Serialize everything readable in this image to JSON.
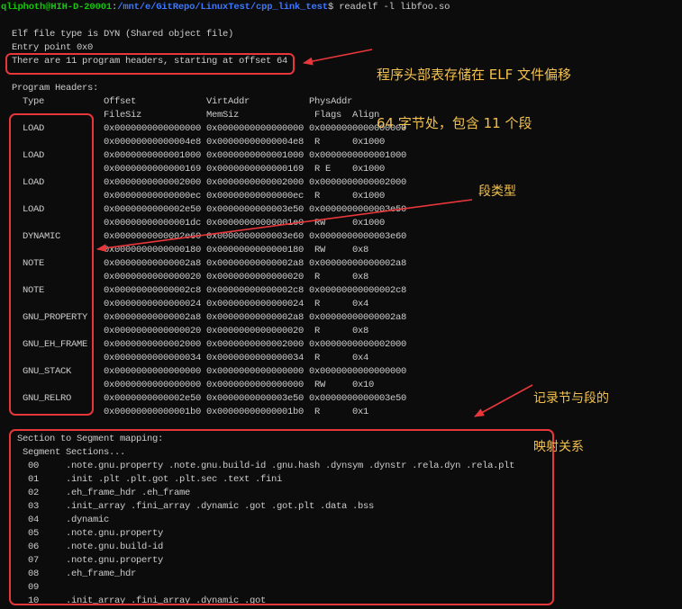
{
  "colors": {
    "background": "#0c0c0c",
    "foreground": "#cccccc",
    "prompt_user": "#16c60c",
    "prompt_path": "#3b78ff",
    "annotation_box": "#e8373b",
    "annotation_text": "#f2c14e"
  },
  "prompt": {
    "user_host": "qliphoth@HIH-D-20001",
    "separator": ":",
    "cwd": "/mnt/e/GitRepo/LinuxTest/cpp_link_test",
    "command": "$ readelf -l libfoo.so"
  },
  "output": {
    "file_type": "Elf file type is DYN (Shared object file)",
    "entry_point": "Entry point 0x0",
    "header_count": "There are 11 program headers, starting at offset 64"
  },
  "program_headers": {
    "title": "Program Headers:",
    "columns_line1": {
      "type": "Type",
      "offset": "Offset",
      "virtaddr": "VirtAddr",
      "physaddr": "PhysAddr"
    },
    "columns_line2": {
      "filesiz": "FileSiz",
      "memsiz": "MemSiz",
      "flags": "Flags",
      "align": "Align"
    },
    "rows": [
      {
        "type": "LOAD",
        "offset": "0x0000000000000000",
        "virtaddr": "0x0000000000000000",
        "physaddr": "0x0000000000000000",
        "filesiz": "0x00000000000004e8",
        "memsiz": "0x00000000000004e8",
        "flags": "R",
        "align": "0x1000"
      },
      {
        "type": "LOAD",
        "offset": "0x0000000000001000",
        "virtaddr": "0x0000000000001000",
        "physaddr": "0x0000000000001000",
        "filesiz": "0x0000000000000169",
        "memsiz": "0x0000000000000169",
        "flags": "R E",
        "align": "0x1000"
      },
      {
        "type": "LOAD",
        "offset": "0x0000000000002000",
        "virtaddr": "0x0000000000002000",
        "physaddr": "0x0000000000002000",
        "filesiz": "0x00000000000000ec",
        "memsiz": "0x00000000000000ec",
        "flags": "R",
        "align": "0x1000"
      },
      {
        "type": "LOAD",
        "offset": "0x0000000000002e50",
        "virtaddr": "0x0000000000003e50",
        "physaddr": "0x0000000000003e50",
        "filesiz": "0x00000000000001dc",
        "memsiz": "0x00000000000001e0",
        "flags": "RW",
        "align": "0x1000"
      },
      {
        "type": "DYNAMIC",
        "offset": "0x0000000000002e60",
        "virtaddr": "0x0000000000003e60",
        "physaddr": "0x0000000000003e60",
        "filesiz": "0x0000000000000180",
        "memsiz": "0x0000000000000180",
        "flags": "RW",
        "align": "0x8"
      },
      {
        "type": "NOTE",
        "offset": "0x00000000000002a8",
        "virtaddr": "0x00000000000002a8",
        "physaddr": "0x00000000000002a8",
        "filesiz": "0x0000000000000020",
        "memsiz": "0x0000000000000020",
        "flags": "R",
        "align": "0x8"
      },
      {
        "type": "NOTE",
        "offset": "0x00000000000002c8",
        "virtaddr": "0x00000000000002c8",
        "physaddr": "0x00000000000002c8",
        "filesiz": "0x0000000000000024",
        "memsiz": "0x0000000000000024",
        "flags": "R",
        "align": "0x4"
      },
      {
        "type": "GNU_PROPERTY",
        "offset": "0x00000000000002a8",
        "virtaddr": "0x00000000000002a8",
        "physaddr": "0x00000000000002a8",
        "filesiz": "0x0000000000000020",
        "memsiz": "0x0000000000000020",
        "flags": "R",
        "align": "0x8"
      },
      {
        "type": "GNU_EH_FRAME",
        "offset": "0x0000000000002000",
        "virtaddr": "0x0000000000002000",
        "physaddr": "0x0000000000002000",
        "filesiz": "0x0000000000000034",
        "memsiz": "0x0000000000000034",
        "flags": "R",
        "align": "0x4"
      },
      {
        "type": "GNU_STACK",
        "offset": "0x0000000000000000",
        "virtaddr": "0x0000000000000000",
        "physaddr": "0x0000000000000000",
        "filesiz": "0x0000000000000000",
        "memsiz": "0x0000000000000000",
        "flags": "RW",
        "align": "0x10"
      },
      {
        "type": "GNU_RELRO",
        "offset": "0x0000000000002e50",
        "virtaddr": "0x0000000000003e50",
        "physaddr": "0x0000000000003e50",
        "filesiz": "0x00000000000001b0",
        "memsiz": "0x00000000000001b0",
        "flags": "R",
        "align": "0x1"
      }
    ]
  },
  "section_mapping": {
    "title": "Section to Segment mapping:",
    "header": "Segment Sections...",
    "rows": [
      {
        "segment": "00",
        "sections": ".note.gnu.property .note.gnu.build-id .gnu.hash .dynsym .dynstr .rela.dyn .rela.plt"
      },
      {
        "segment": "01",
        "sections": ".init .plt .plt.got .plt.sec .text .fini"
      },
      {
        "segment": "02",
        "sections": ".eh_frame_hdr .eh_frame"
      },
      {
        "segment": "03",
        "sections": ".init_array .fini_array .dynamic .got .got.plt .data .bss"
      },
      {
        "segment": "04",
        "sections": ".dynamic"
      },
      {
        "segment": "05",
        "sections": ".note.gnu.property"
      },
      {
        "segment": "06",
        "sections": ".note.gnu.build-id"
      },
      {
        "segment": "07",
        "sections": ".note.gnu.property"
      },
      {
        "segment": "08",
        "sections": ".eh_frame_hdr"
      },
      {
        "segment": "09",
        "sections": ""
      },
      {
        "segment": "10",
        "sections": ".init_array .fini_array .dynamic .got"
      }
    ]
  },
  "annotations": {
    "offset_note": [
      "程序头部表存储在 ELF 文件偏移",
      "64 字节处，包含 11 个段"
    ],
    "type_note": "段类型",
    "mapping_note": [
      "记录节与段的",
      "映射关系"
    ]
  }
}
